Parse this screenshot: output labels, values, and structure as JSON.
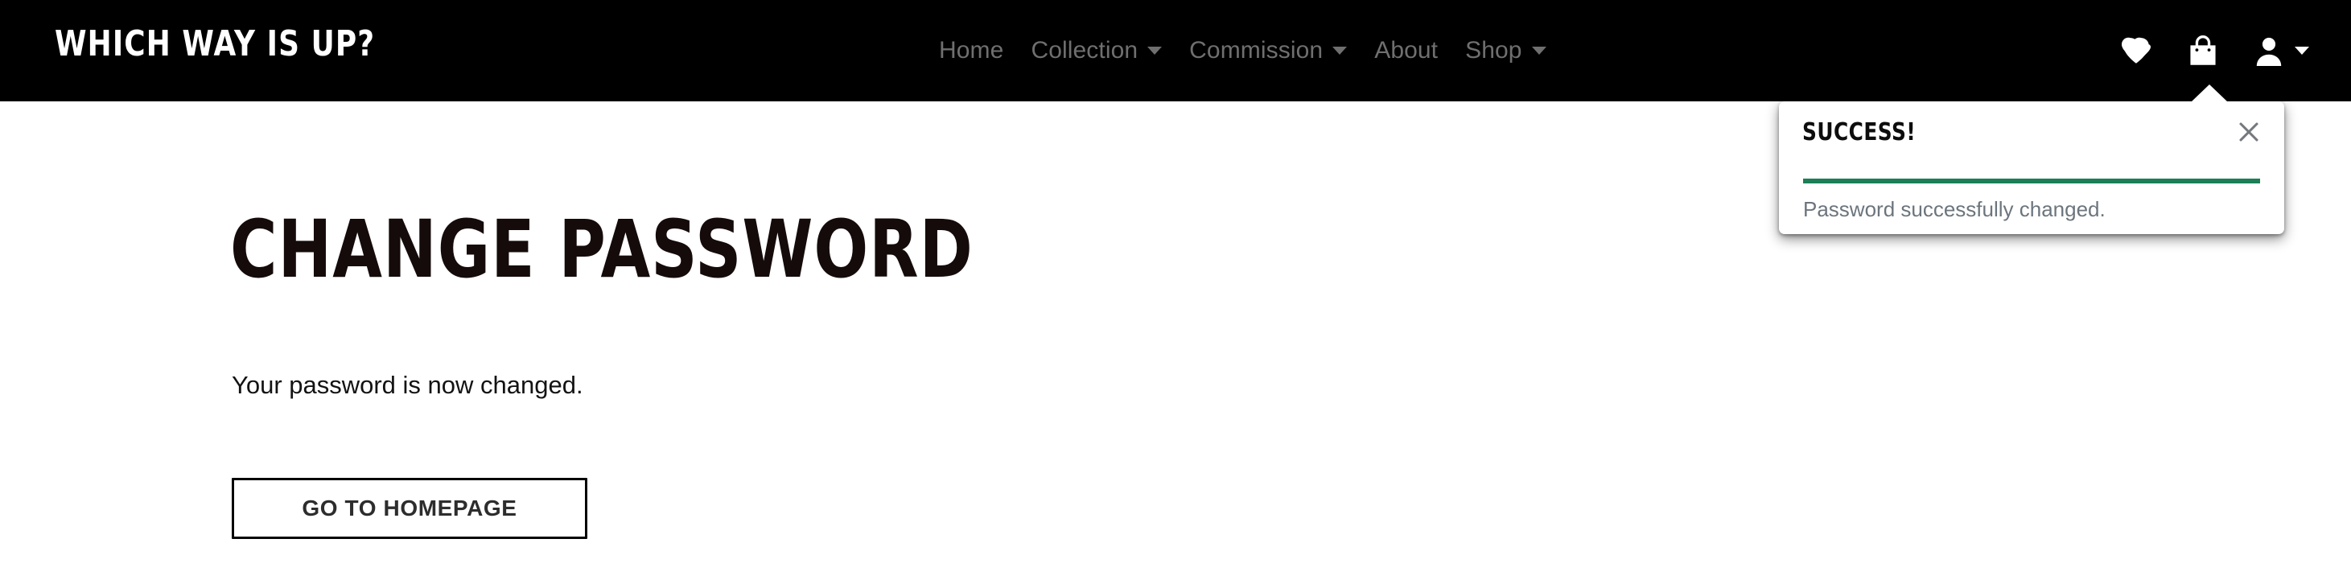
{
  "header": {
    "brand": "WHICH WAY IS UP?",
    "nav_items": [
      {
        "label": "Home",
        "has_dropdown": false
      },
      {
        "label": "Collection",
        "has_dropdown": true
      },
      {
        "label": "Commission",
        "has_dropdown": true
      },
      {
        "label": "About",
        "has_dropdown": false
      },
      {
        "label": "Shop",
        "has_dropdown": true
      }
    ],
    "icons": [
      {
        "name": "heart-icon",
        "title": "Wishlist"
      },
      {
        "name": "shopping-bag-icon",
        "title": "Cart"
      },
      {
        "name": "user-account-icon",
        "title": "Account"
      }
    ]
  },
  "main": {
    "title": "CHANGE PASSWORD",
    "body_text": "Your password is now changed.",
    "button_label": "GO TO HOMEPAGE"
  },
  "toast": {
    "title": "SUCCESS!",
    "message": "Password successfully changed.",
    "close_label": "Close",
    "accent_color": "#1c7f56"
  },
  "colors": {
    "header_bg": "#000000",
    "nav_text": "#6f6f6f",
    "page_bg": "#ffffff",
    "heading": "#150b0b",
    "muted_text": "#6c757d",
    "success_green": "#1c7f56",
    "button_border": "#040404"
  }
}
